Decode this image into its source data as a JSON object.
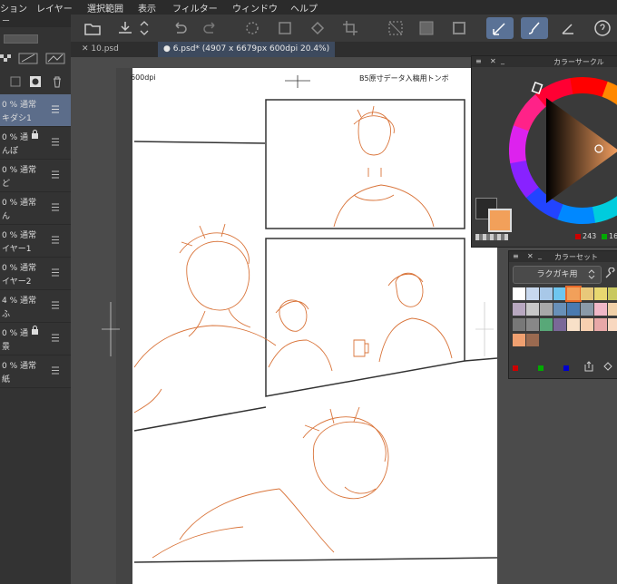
{
  "menubar": {
    "items": [
      "ション",
      "レイヤー",
      "選択範囲",
      "表示",
      "フィルター",
      "ウィンドウ",
      "ヘルプ"
    ]
  },
  "tabs": [
    {
      "label": "10.psd"
    },
    {
      "label": "6.psd* (4907 x 6679px 600dpi 20.4%)"
    }
  ],
  "layer_panel": {
    "title": "ー",
    "layers": [
      {
        "line1": "0 % 通常",
        "line2": "キダシ1",
        "selected": true,
        "locked": false
      },
      {
        "line1": "0 % 通",
        "line2": "んぽ",
        "selected": false,
        "locked": true
      },
      {
        "line1": "0 % 通常",
        "line2": "ど",
        "selected": false,
        "locked": false
      },
      {
        "line1": "0 % 通常",
        "line2": "ん",
        "selected": false,
        "locked": false
      },
      {
        "line1": "0 % 通常",
        "line2": "イヤー1",
        "selected": false,
        "locked": false
      },
      {
        "line1": "0 % 通常",
        "line2": "イヤー2",
        "selected": false,
        "locked": false
      },
      {
        "line1": "4 % 通常",
        "line2": "ふ",
        "selected": false,
        "locked": false
      },
      {
        "line1": "0 % 通",
        "line2": "景",
        "selected": false,
        "locked": true
      },
      {
        "line1": "0 % 通常",
        "line2": "紙",
        "selected": false,
        "locked": false
      }
    ]
  },
  "canvas": {
    "dpi_label": "600dpi",
    "template_label": "B5原寸データ入稿用トンボ"
  },
  "color_wheel_panel": {
    "title": "カラーサークル",
    "readout_r": "243",
    "readout_g": "16",
    "colors": {
      "main": "#f2a05a",
      "sub": "#2a2a2a"
    }
  },
  "color_set_panel": {
    "title": "カラーセット",
    "set_name": "ラクガキ用",
    "swatches": [
      "#ffffff",
      "#c8d8ee",
      "#a8c8e8",
      "#6ec6f0",
      "#f2a05a",
      "#e8c87a",
      "#e8d870",
      "#c8c860",
      "#b8a8c0",
      "#c8c8c8",
      "#a8a8a8",
      "#6890b8",
      "#4a7ab0",
      "#8a9aa8",
      "#f0b8c8",
      "#f0d0a8",
      "#787878",
      "#888888",
      "#58a878",
      "#7a6898",
      "#f8e0c8",
      "#f8d0b0",
      "#e8a8a8",
      "#f8d8c0",
      "#f0a070",
      "#9a6a50"
    ]
  }
}
